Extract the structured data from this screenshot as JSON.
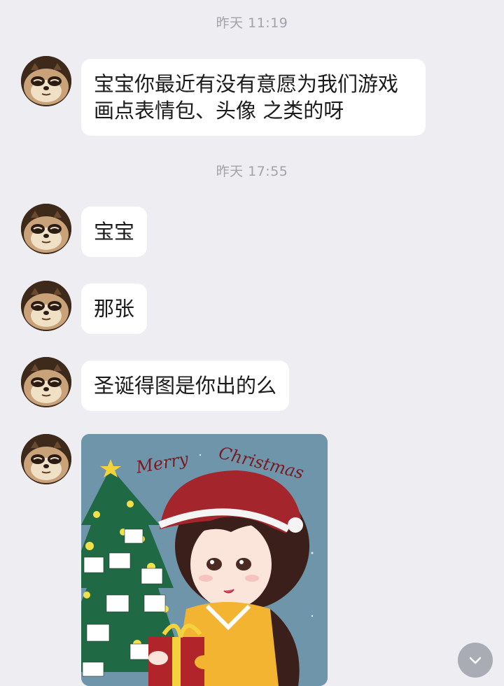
{
  "timestamps": [
    "昨天 11:19",
    "昨天 17:55"
  ],
  "messages": [
    {
      "text": "宝宝你最近有没有意愿为我们游戏\n画点表情包、头像 之类的呀"
    },
    {
      "text": "宝宝"
    },
    {
      "text": "那张"
    },
    {
      "text": "圣诞得图是你出的么"
    }
  ],
  "image_message": {
    "caption_left": "Merry",
    "caption_right": "Christmas"
  },
  "icons": {
    "avatar": "tanuki-avatar-icon",
    "scroll": "chevron-down-icon"
  },
  "colors": {
    "background": "#ededf2",
    "bubble": "#ffffff",
    "timestamp": "#a2a2a8",
    "image_bg": "#6f95ab"
  }
}
